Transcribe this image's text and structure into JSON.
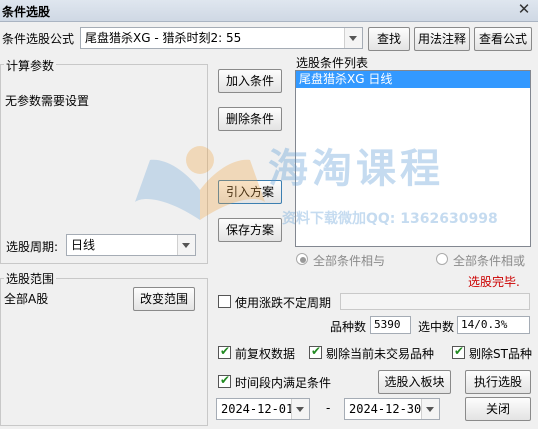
{
  "window": {
    "title": "条件选股",
    "close_glyph": "✕"
  },
  "formula": {
    "label": "条件选股公式",
    "selected": "尾盘猎杀XG  -  猎杀时刻2: 55"
  },
  "top_buttons": {
    "find": "查找",
    "usage": "用法注释",
    "view": "查看公式"
  },
  "params": {
    "group_label": "计算参数",
    "message": "无参数需要设置"
  },
  "mid_buttons": {
    "add": "加入条件",
    "delete": "删除条件",
    "import": "引入方案",
    "save": "保存方案"
  },
  "condition_list": {
    "label": "选股条件列表",
    "items": [
      "尾盘猎杀XG  日线"
    ]
  },
  "period": {
    "label": "选股周期:",
    "value": "日线"
  },
  "logic": {
    "and_label": "全部条件相与",
    "or_label": "全部条件相或",
    "status": "选股完毕."
  },
  "range": {
    "group_label": "选股范围",
    "value": "全部A股",
    "change_button": "改变范围"
  },
  "options": {
    "unfixed_period": "使用涨跌不定周期",
    "count_label": "品种数",
    "count_value": "5390",
    "selected_label": "选中数",
    "selected_value": "14/0.3%",
    "pre_adjust": "前复权数据",
    "exclude_untraded": "剔除当前未交易品种",
    "exclude_st": "剔除ST品种",
    "interval": "时间段内满足条件"
  },
  "dates": {
    "start": "2024-12-01",
    "separator": "-",
    "end": "2024-12-30"
  },
  "bottom_buttons": {
    "to_block": "选股入板块",
    "execute": "执行选股",
    "close": "关闭"
  },
  "watermark": {
    "title": "海淘课程",
    "subtitle": "资料下载微加QQ: 1362630998"
  },
  "colors": {
    "selection": "#3399ff",
    "status_text": "#cc0000",
    "watermark": "#5b9bd5",
    "accent_border": "#3c7fb1"
  }
}
